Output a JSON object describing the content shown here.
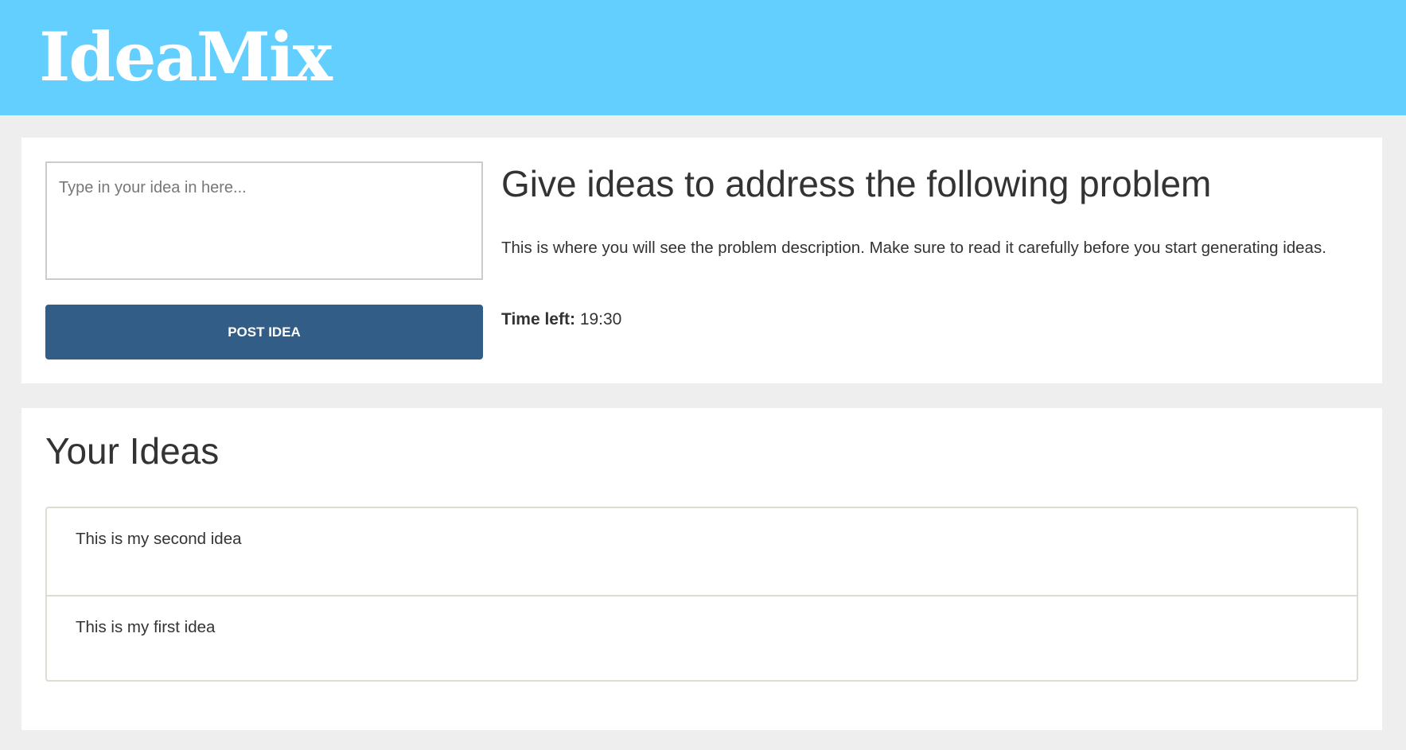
{
  "header": {
    "logo_text": "IdeaMix",
    "background_color": "#63cfff"
  },
  "composer": {
    "placeholder": "Type in your idea in here...",
    "value": "",
    "post_button_label": "POST IDEA",
    "post_button_color": "#315d87"
  },
  "problem": {
    "title": "Give ideas to address the following problem",
    "description": "This is where you will see the problem description. Make sure to read it carefully before you start generating ideas.",
    "time_left_label": "Time left:",
    "time_left_value": "19:30"
  },
  "ideas": {
    "title": "Your Ideas",
    "items": [
      {
        "text": "This is my second idea"
      },
      {
        "text": "This is my first idea"
      }
    ]
  }
}
